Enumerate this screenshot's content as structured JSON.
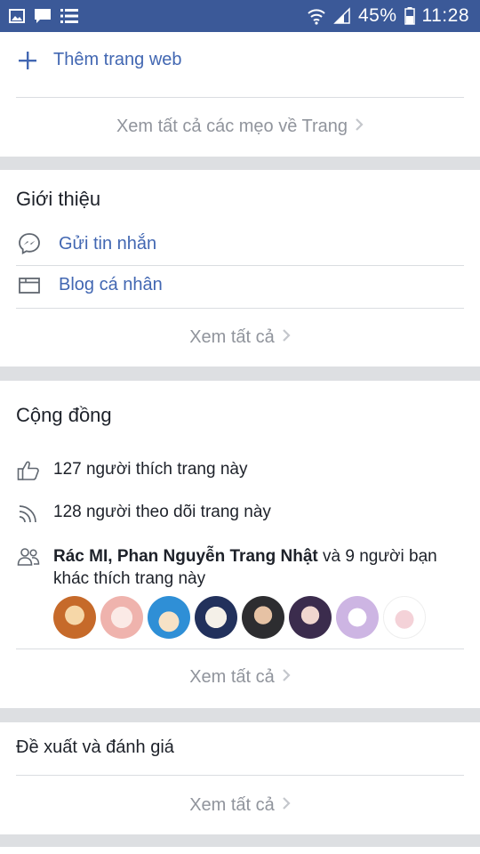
{
  "status_bar": {
    "battery": "45%",
    "time": "11:28"
  },
  "tips": {
    "add_website": "Thêm trang web",
    "see_all": "Xem tất cả các mẹo về Trang"
  },
  "about": {
    "title": "Giới thiệu",
    "items": [
      {
        "label": "Gửi tin nhắn",
        "icon": "messenger-icon"
      },
      {
        "label": "Blog cá nhân",
        "icon": "browser-window-icon"
      }
    ],
    "see_all": "Xem tất cả"
  },
  "community": {
    "title": "Cộng đồng",
    "likes": "127 người thích trang này",
    "follows": "128 người theo dõi trang này",
    "friends": {
      "name1": "Rác MI",
      "separator": ", ",
      "name2": "Phan Nguyễn Trang Nhật",
      "rest": " và 9 người bạn khác thích trang này"
    },
    "avatar_colors": [
      "#e6a25b",
      "#f3d2d0",
      "#6fc0ec",
      "#2c3e6e",
      "#3f3f44",
      "#4a3a5e",
      "#d9c8ea",
      "#f1c9cf"
    ],
    "see_all": "Xem tất cả"
  },
  "recommendations": {
    "title": "Đề xuất và đánh giá",
    "see_all": "Xem tất cả"
  },
  "colors": {
    "brand": "#3b5998",
    "link": "#4267b2",
    "muted": "#90949c"
  }
}
